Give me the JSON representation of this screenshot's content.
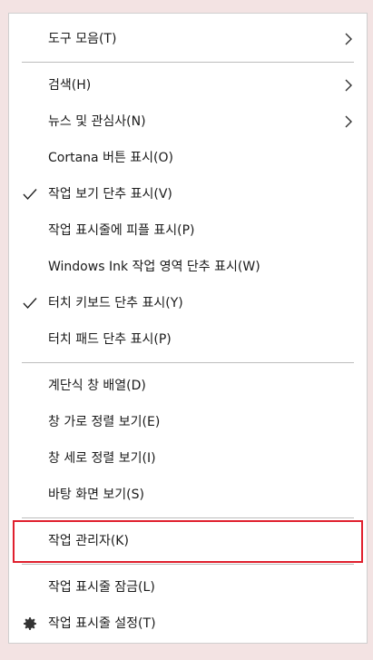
{
  "menu": {
    "toolbars": "도구 모음(T)",
    "search": "검색(H)",
    "news": "뉴스 및 관심사(N)",
    "cortana": "Cortana 버튼 표시(O)",
    "task_view": "작업 보기 단추 표시(V)",
    "people": "작업 표시줄에 피플 표시(P)",
    "ink": "Windows Ink 작업 영역 단추 표시(W)",
    "touch_keyboard": "터치 키보드 단추 표시(Y)",
    "touchpad": "터치 패드 단추 표시(P)",
    "cascade": "계단식 창 배열(D)",
    "stacked": "창 가로 정렬 보기(E)",
    "side_by_side": "창 세로 정렬 보기(I)",
    "show_desktop": "바탕 화면 보기(S)",
    "task_manager": "작업 관리자(K)",
    "lock_taskbar": "작업 표시줄 잠금(L)",
    "taskbar_settings": "작업 표시줄 설정(T)"
  },
  "checked": {
    "task_view": true,
    "touch_keyboard": true
  },
  "icons": {
    "submenu": "chevron-right-icon",
    "checked": "checkmark-icon",
    "settings": "gear-icon"
  },
  "colors": {
    "highlight_border": "#e0202e",
    "menu_background": "#ffffff",
    "desktop_background": "#f3e3e3"
  }
}
